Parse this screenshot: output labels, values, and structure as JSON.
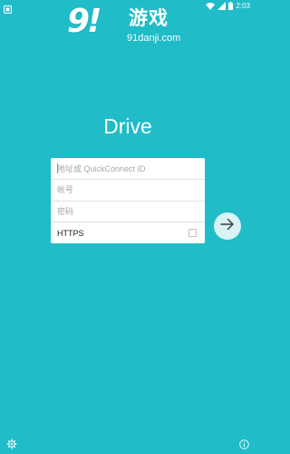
{
  "status_bar": {
    "time": "2:03",
    "icons": [
      "android-notification-icon",
      "wifi-icon",
      "signal-icon",
      "battery-icon"
    ]
  },
  "watermark": {
    "logo_number": "9",
    "logo_mark": "!",
    "brand_text": "游戏",
    "url_text": "91danji.com"
  },
  "app": {
    "title": "Drive"
  },
  "login_form": {
    "address_placeholder": "地址或 QuickConnect ID",
    "account_placeholder": "帐号",
    "password_placeholder": "密码",
    "https_label": "HTTPS",
    "https_checked": false
  },
  "actions": {
    "go_icon": "arrow-right-icon",
    "settings_icon": "gear-icon",
    "info_icon": "info-icon"
  },
  "colors": {
    "background": "#20bcc8",
    "card": "#ffffff",
    "go_button": "#d9f3f5"
  }
}
